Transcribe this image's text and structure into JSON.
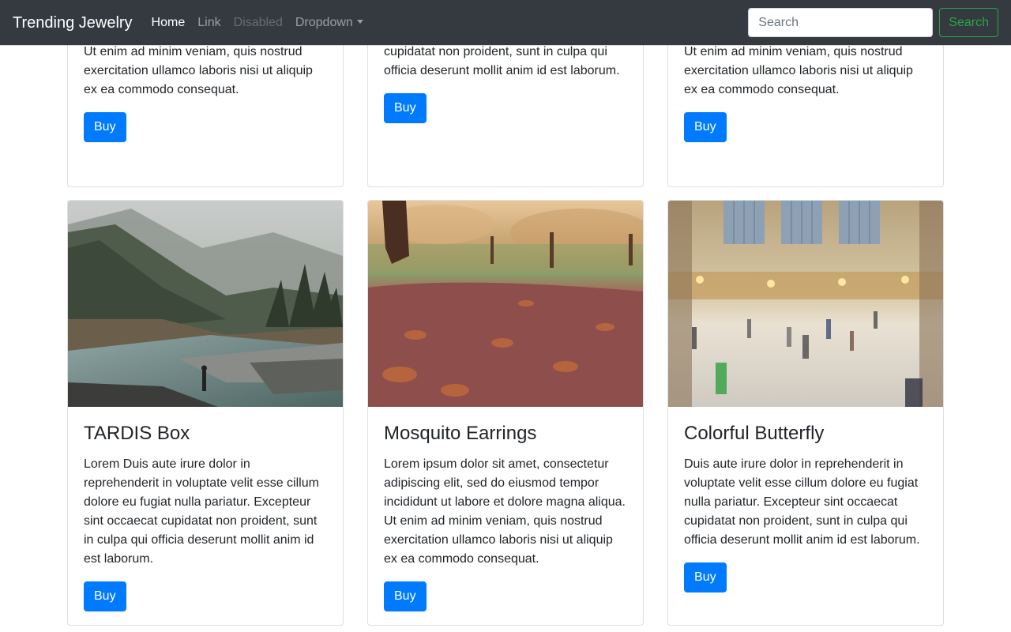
{
  "navbar": {
    "brand": "Trending Jewelry",
    "links": [
      {
        "label": "Home",
        "state": "active"
      },
      {
        "label": "Link",
        "state": "normal"
      },
      {
        "label": "Disabled",
        "state": "disabled"
      },
      {
        "label": "Dropdown",
        "state": "dropdown"
      }
    ],
    "search_placeholder": "Search",
    "search_button": "Search"
  },
  "top_row": [
    {
      "text": "adipiscing elit, sed do eiusmod tempor incididunt ut labore et dolore magna aliqua. Ut enim ad minim veniam, quis nostrud exercitation ullamco laboris nisi ut aliquip ex ea commodo consequat.",
      "button": "Buy"
    },
    {
      "text": "voluptate velit esse cillum dolore eu fugiat nulla pariatur. Excepteur sint occaecat cupidatat non proident, sunt in culpa qui officia deserunt mollit anim id est laborum.",
      "button": "Buy"
    },
    {
      "text": "adipiscing elit, sed do eiusmod tempor incididunt ut labore et dolore magna aliqua. Ut enim ad minim veniam, quis nostrud exercitation ullamco laboris nisi ut aliquip ex ea commodo consequat.",
      "button": "Buy"
    }
  ],
  "products": [
    {
      "title": "TARDIS Box",
      "text": "Lorem Duis aute irure dolor in reprehenderit in voluptate velit esse cillum dolore eu fugiat nulla pariatur. Excepteur sint occaecat cupidatat non proident, sunt in culpa qui officia deserunt mollit anim id est laborum.",
      "button": "Buy",
      "image": "misty-river-mountain"
    },
    {
      "title": "Mosquito Earrings",
      "text": "Lorem ipsum dolor sit amet, consectetur adipiscing elit, sed do eiusmod tempor incididunt ut labore et dolore magna aliqua. Ut enim ad minim veniam, quis nostrud exercitation ullamco laboris nisi ut aliquip ex ea commodo consequat.",
      "button": "Buy",
      "image": "autumn-leaves-path"
    },
    {
      "title": "Colorful Butterfly",
      "text": "Duis aute irure dolor in reprehenderit in voluptate velit esse cillum dolore eu fugiat nulla pariatur. Excepteur sint occaecat cupidatat non proident, sunt in culpa qui officia deserunt mollit anim id est laborum.",
      "button": "Buy",
      "image": "busy-train-station-hall"
    }
  ],
  "colors": {
    "navbar_bg": "#343a40",
    "primary": "#007bff",
    "success": "#28a745"
  }
}
